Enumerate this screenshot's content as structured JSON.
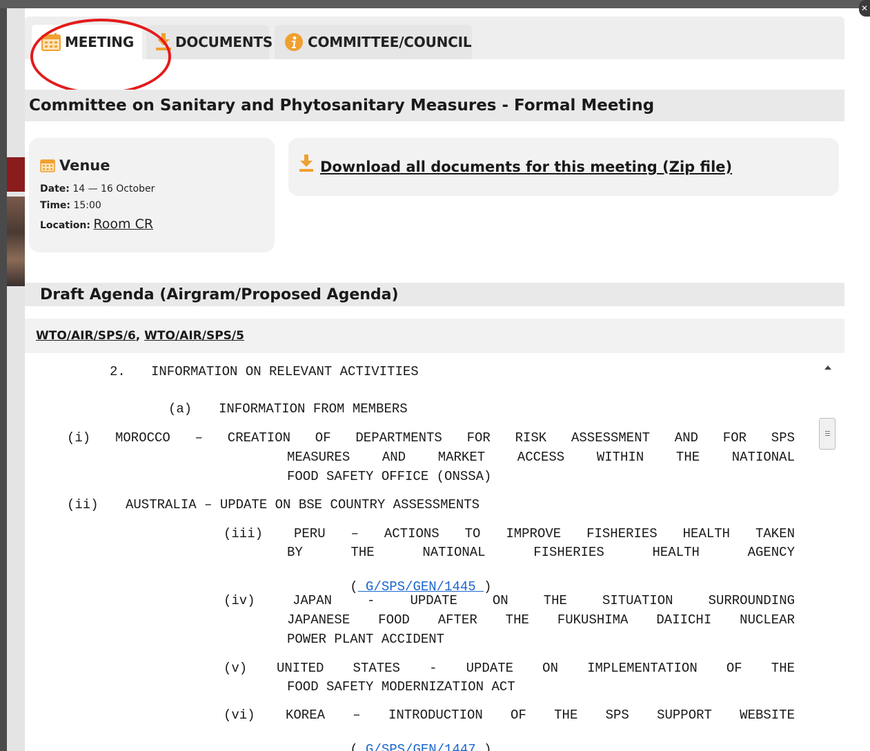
{
  "tabs": {
    "meeting": "MEETING",
    "documents": "DOCUMENTS",
    "committee": "COMMITTEE/COUNCIL"
  },
  "meeting_title": "Committee on Sanitary and Phytosanitary Measures - Formal Meeting",
  "venue": {
    "heading": "Venue",
    "date_label": "Date:",
    "date_value": "14 — 16 October",
    "time_label": "Time:",
    "time_value": "15:00",
    "location_label": "Location:",
    "location_value": "Room CR"
  },
  "download": {
    "label": "Download all documents for this meeting (Zip file)"
  },
  "agenda": {
    "heading": "Draft Agenda (Airgram/Proposed Agenda)",
    "doc_links": [
      "WTO/AIR/SPS/6",
      "WTO/AIR/SPS/5"
    ],
    "doc_separator": ", ",
    "section_number": "2.",
    "section_title": "INFORMATION ON RELEVANT ACTIVITIES",
    "sub_number": "(a)",
    "sub_title": "INFORMATION FROM MEMBERS",
    "items": [
      {
        "num": "(i)",
        "line1": "MOROCCO – CREATION OF DEPARTMENTS FOR RISK ASSESSMENT AND FOR SPS",
        "line2": "MEASURES AND MARKET ACCESS WITHIN THE NATIONAL",
        "line3": "FOOD SAFETY OFFICE (ONSSA)"
      },
      {
        "num": "(ii)",
        "line1": "AUSTRALIA – UPDATE ON BSE COUNTRY ASSESSMENTS"
      },
      {
        "num": "(iii)",
        "line1": "PERU – ACTIONS TO IMPROVE FISHERIES HEALTH TAKEN",
        "line2": "BY THE NATIONAL FISHERIES HEALTH AGENCY",
        "doc": "G/SPS/GEN/1445"
      },
      {
        "num": "(iv)",
        "line1": "JAPAN - UPDATE ON THE SITUATION SURROUNDING",
        "line2": "JAPANESE FOOD AFTER THE FUKUSHIMA DAIICHI NUCLEAR",
        "line3": "POWER PLANT ACCIDENT"
      },
      {
        "num": "(v)",
        "line1": "UNITED STATES - UPDATE ON IMPLEMENTATION OF THE",
        "line2": "FOOD SAFETY MODERNIZATION ACT"
      },
      {
        "num": "(vi)",
        "line1": "KOREA – INTRODUCTION OF THE SPS SUPPORT WEBSITE",
        "doc": "G/SPS/GEN/1447"
      }
    ],
    "paren_open": "(",
    "paren_close": ")"
  },
  "colors": {
    "accent_orange": "#f0a030",
    "link_blue": "#1a66cc",
    "highlight_circle": "#e31b1b"
  },
  "icons": [
    "calendar-icon",
    "download-icon",
    "info-icon"
  ]
}
